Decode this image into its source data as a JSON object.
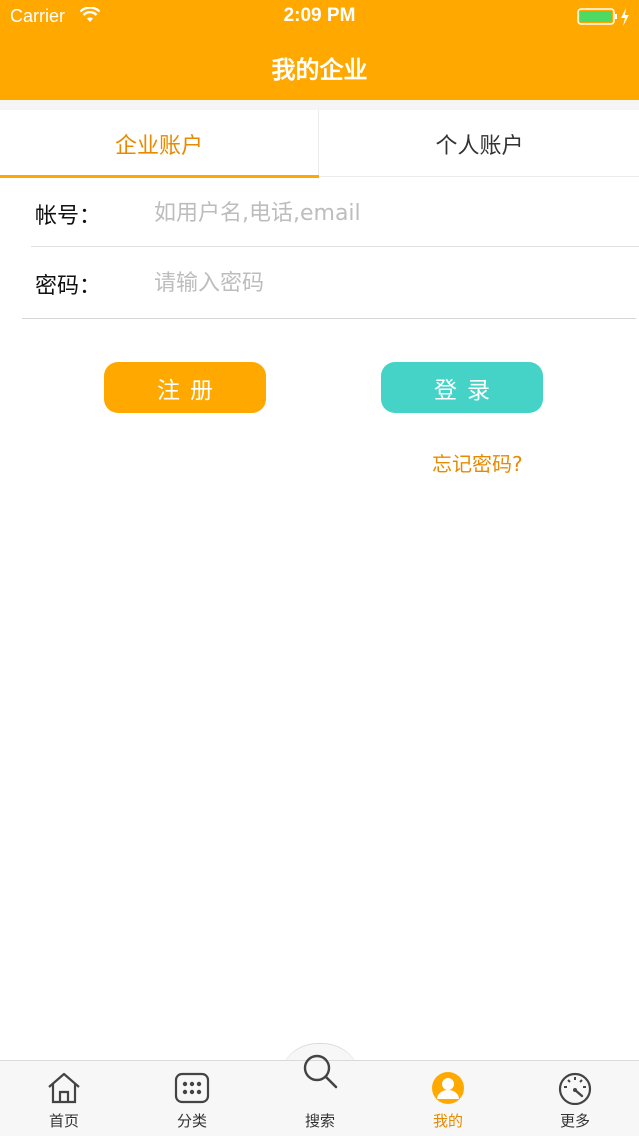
{
  "status_bar": {
    "carrier": "Carrier",
    "time": "2:09 PM"
  },
  "header": {
    "title": "我的企业"
  },
  "tabs": [
    {
      "label": "企业账户",
      "active": true
    },
    {
      "label": "个人账户",
      "active": false
    }
  ],
  "form": {
    "account_label": "帐号：",
    "account_placeholder": "如用户名,电话,email",
    "password_label": "密码：",
    "password_placeholder": "请输入密码"
  },
  "buttons": {
    "register": "注册",
    "login": "登录",
    "forgot": "忘记密码?"
  },
  "tabbar": [
    {
      "label": "首页",
      "icon": "home-icon"
    },
    {
      "label": "分类",
      "icon": "grid-icon"
    },
    {
      "label": "搜索",
      "icon": "search-icon"
    },
    {
      "label": "我的",
      "icon": "user-icon",
      "active": true
    },
    {
      "label": "更多",
      "icon": "gauge-icon"
    }
  ],
  "colors": {
    "accent": "#FFA800",
    "accent_text": "#E88A00",
    "login": "#45D3C8"
  }
}
